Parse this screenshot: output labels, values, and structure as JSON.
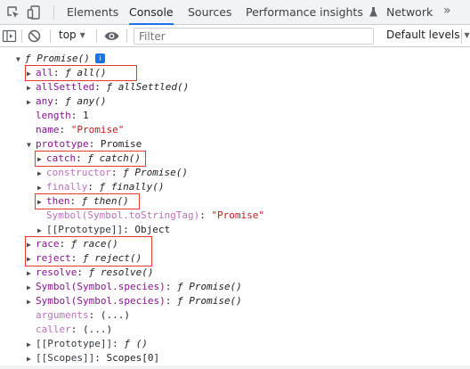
{
  "tabs": [
    {
      "label": "Elements",
      "active": false
    },
    {
      "label": "Console",
      "active": true
    },
    {
      "label": "Sources",
      "active": false
    },
    {
      "label": "Performance insights",
      "active": false
    },
    {
      "label": "Network",
      "active": false
    }
  ],
  "tabs_more": "»",
  "perf_icon": "flask-icon",
  "toolbar": {
    "context": "top",
    "filter_placeholder": "Filter",
    "levels": "Default levels"
  },
  "console": {
    "root": {
      "f": "ƒ",
      "name": "Promise()",
      "info": "i"
    },
    "rows": [
      {
        "key": "all",
        "sep": ": ",
        "f": "ƒ",
        "val": "all()"
      },
      {
        "key": "allSettled",
        "sep": ": ",
        "f": "ƒ",
        "val": "allSettled()"
      },
      {
        "key": "any",
        "sep": ": ",
        "f": "ƒ",
        "val": "any()"
      },
      {
        "key": "length",
        "sep": ": ",
        "val": "1"
      },
      {
        "key": "name",
        "sep": ": ",
        "val": "\"Promise\""
      },
      {
        "key": "prototype",
        "sep": ": ",
        "val": "Promise"
      },
      {
        "key": "catch",
        "sep": ": ",
        "f": "ƒ",
        "val": "catch()"
      },
      {
        "key": "constructor",
        "sep": ": ",
        "f": "ƒ",
        "val": "Promise()"
      },
      {
        "key": "finally",
        "sep": ": ",
        "f": "ƒ",
        "val": "finally()"
      },
      {
        "key": "then",
        "sep": ": ",
        "f": "ƒ",
        "val": "then()"
      },
      {
        "key": "Symbol(Symbol.toStringTag)",
        "sep": ": ",
        "val": "\"Promise\""
      },
      {
        "key": "[[Prototype]]",
        "sep": ": ",
        "val": "Object"
      },
      {
        "key": "race",
        "sep": ": ",
        "f": "ƒ",
        "val": "race()"
      },
      {
        "key": "reject",
        "sep": ": ",
        "f": "ƒ",
        "val": "reject()"
      },
      {
        "key": "resolve",
        "sep": ": ",
        "f": "ƒ",
        "val": "resolve()"
      },
      {
        "key": "Symbol(Symbol.species)",
        "sep": ": ",
        "f": "ƒ",
        "val": "Promise()"
      },
      {
        "key": "Symbol(Symbol.species)",
        "sep": ": ",
        "f": "ƒ",
        "val": "Promise()"
      },
      {
        "key": "arguments",
        "sep": ": ",
        "val": "(...)"
      },
      {
        "key": "caller",
        "sep": ": ",
        "val": "(...)"
      },
      {
        "key": "[[Prototype]]",
        "sep": ": ",
        "f": "ƒ",
        "val": "()"
      },
      {
        "key": "[[Scopes]]",
        "sep": ": ",
        "val": "Scopes[0]"
      }
    ]
  },
  "colors": {
    "key": "#881391",
    "string": "#c41a16",
    "number": "#1c00cf",
    "highlight": "#e53935",
    "accent": "#1a73e8"
  }
}
